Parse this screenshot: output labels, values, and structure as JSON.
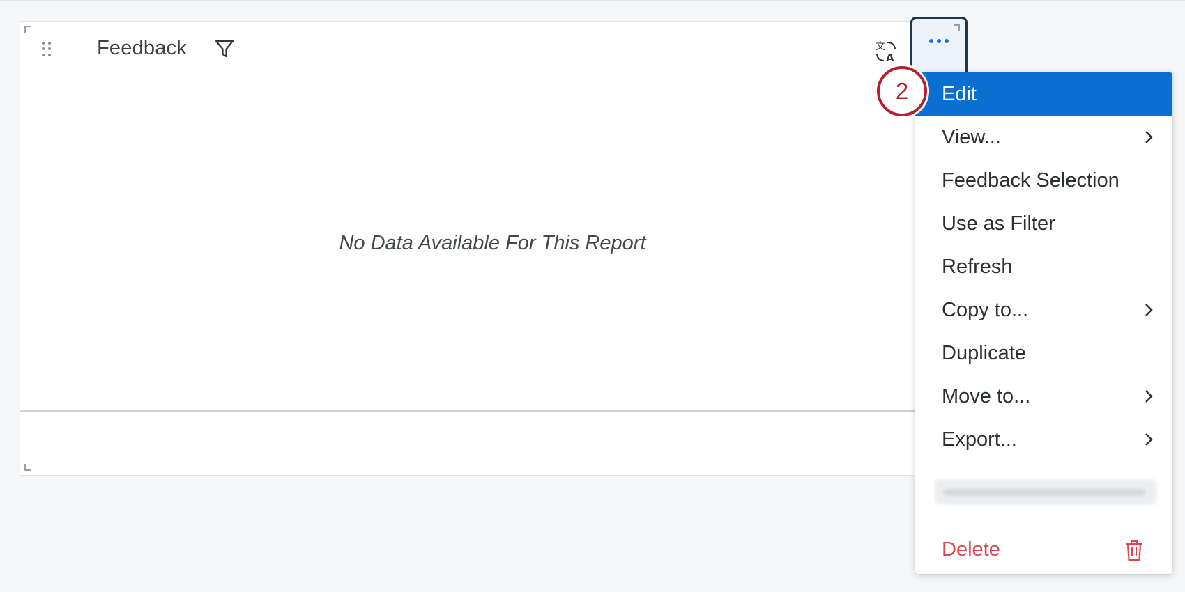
{
  "widget": {
    "title": "Feedback",
    "empty_message": "No Data Available For This Report",
    "icons": {
      "drag": "drag-handle-icon",
      "filter": "filter-icon",
      "translate": "translate-icon",
      "more": "more-options-icon"
    }
  },
  "menu": {
    "items": [
      {
        "label": "Edit",
        "active": true,
        "submenu": false
      },
      {
        "label": "View...",
        "submenu": true
      },
      {
        "label": "Feedback Selection",
        "submenu": false
      },
      {
        "label": "Use as Filter",
        "submenu": false
      },
      {
        "label": "Refresh",
        "submenu": false
      },
      {
        "label": "Copy to...",
        "submenu": true
      },
      {
        "label": "Duplicate",
        "submenu": false
      },
      {
        "label": "Move to...",
        "submenu": true
      },
      {
        "label": "Export...",
        "submenu": true
      }
    ],
    "delete_label": "Delete",
    "colors": {
      "active": "#0b6fd1",
      "delete": "#e0454f"
    }
  },
  "step_badge": {
    "number": "2",
    "color": "#b5202f"
  }
}
